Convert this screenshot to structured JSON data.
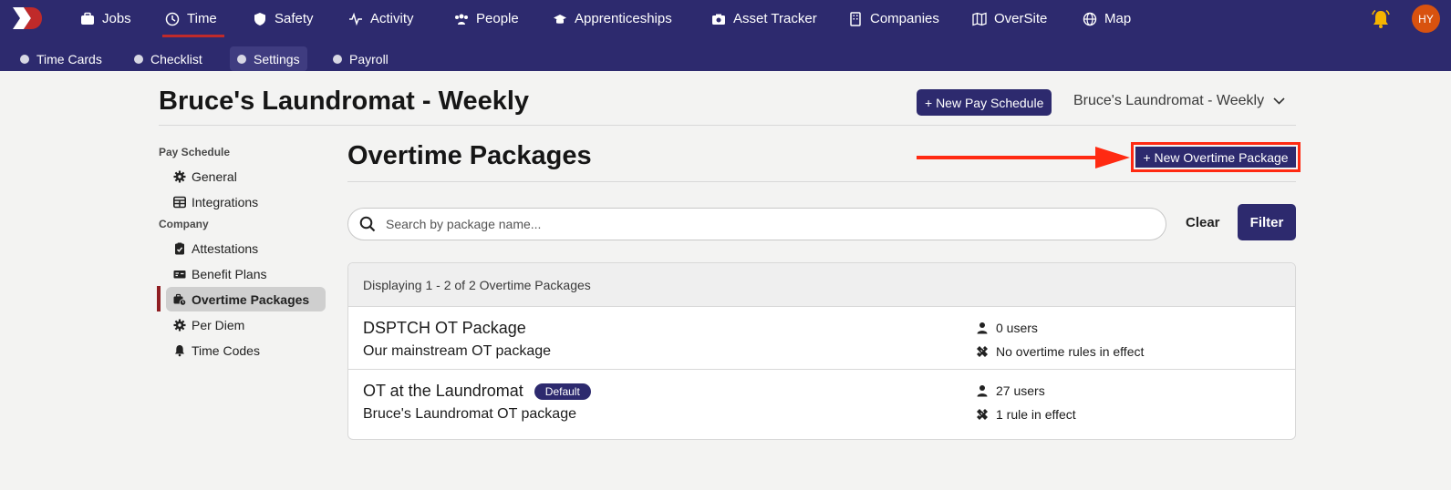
{
  "nav": {
    "items": [
      {
        "label": "Jobs",
        "icon": "briefcase-icon"
      },
      {
        "label": "Time",
        "icon": "clock-icon"
      },
      {
        "label": "Safety",
        "icon": "shield-icon"
      },
      {
        "label": "Activity",
        "icon": "pulse-icon"
      },
      {
        "label": "People",
        "icon": "people-icon"
      },
      {
        "label": "Apprenticeships",
        "icon": "graduation-cap-icon"
      },
      {
        "label": "Asset Tracker",
        "icon": "camera-icon"
      },
      {
        "label": "Companies",
        "icon": "building-icon"
      },
      {
        "label": "OverSite",
        "icon": "map-icon"
      },
      {
        "label": "Map",
        "icon": "globe-icon"
      }
    ],
    "active": "Time",
    "avatar_initials": "HY"
  },
  "subnav": {
    "items": [
      {
        "label": "Time Cards"
      },
      {
        "label": "Checklist"
      },
      {
        "label": "Settings"
      },
      {
        "label": "Payroll"
      }
    ],
    "active": "Settings"
  },
  "header": {
    "title": "Bruce's Laundromat - Weekly",
    "new_pay_schedule": "+ New Pay Schedule",
    "schedule_select": "Bruce's Laundromat - Weekly"
  },
  "sidebar": {
    "sections": [
      {
        "heading": "Pay Schedule",
        "items": [
          {
            "label": "General",
            "icon": "gear-icon"
          },
          {
            "label": "Integrations",
            "icon": "table-icon"
          }
        ]
      },
      {
        "heading": "Company",
        "items": [
          {
            "label": "Attestations",
            "icon": "clipboard-check-icon"
          },
          {
            "label": "Benefit Plans",
            "icon": "money-check-icon"
          },
          {
            "label": "Overtime Packages",
            "icon": "briefcase-clock-icon"
          },
          {
            "label": "Per Diem",
            "icon": "gear-icon"
          },
          {
            "label": "Time Codes",
            "icon": "bell-icon"
          }
        ]
      }
    ],
    "active": "Overtime Packages"
  },
  "main": {
    "title": "Overtime Packages",
    "new_package_button": "+ New Overtime Package",
    "search": {
      "placeholder": "Search by package name...",
      "value": ""
    },
    "clear_label": "Clear",
    "filter_label": "Filter",
    "table": {
      "summary": "Displaying 1 - 2 of 2 Overtime Packages",
      "rows": [
        {
          "name": "DSPTCH OT Package",
          "badge": "",
          "description": "Our mainstream OT package",
          "users": "0 users",
          "rules": "No overtime rules in effect"
        },
        {
          "name": "OT at the Laundromat",
          "badge": "Default",
          "description": "Bruce's Laundromat OT package",
          "users": "27 users",
          "rules": "1 rule in effect"
        }
      ]
    }
  },
  "colors": {
    "nav_bg": "#2d2a6e",
    "accent_red": "#c02a2a",
    "annotation_red": "#ff2a12",
    "avatar": "#d8520f",
    "bell": "#f5b400"
  }
}
